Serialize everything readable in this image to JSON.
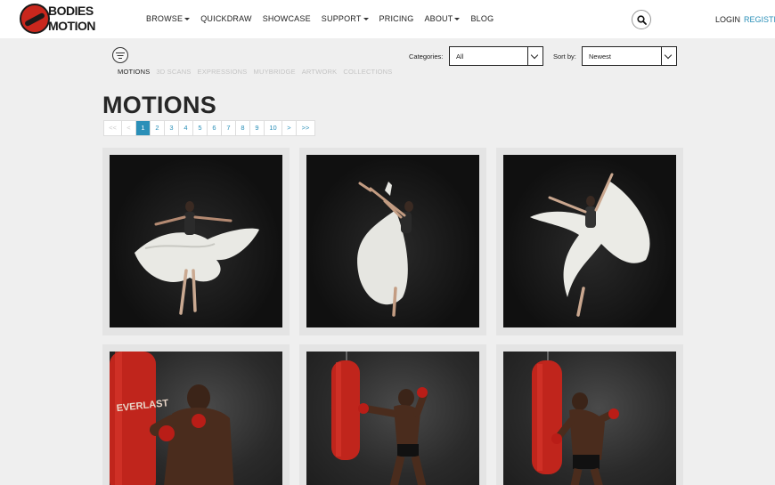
{
  "brand": {
    "line1": "BODIES",
    "on": "IN",
    "line2": "MOTION",
    "accent_color": "#c9271d",
    "link_color": "#2a8fb8"
  },
  "nav": {
    "items": [
      {
        "label": "BROWSE",
        "dropdown": true
      },
      {
        "label": "QUICKDRAW",
        "dropdown": false
      },
      {
        "label": "SHOWCASE",
        "dropdown": false
      },
      {
        "label": "SUPPORT",
        "dropdown": true
      },
      {
        "label": "PRICING",
        "dropdown": false
      },
      {
        "label": "ABOUT",
        "dropdown": true
      },
      {
        "label": "BLOG",
        "dropdown": false
      }
    ],
    "search_icon": "search-icon",
    "login": "LOGIN",
    "register": "REGISTER"
  },
  "filters": {
    "filter_icon": "filter-icon",
    "subtabs": [
      "MOTIONS",
      "3D SCANS",
      "EXPRESSIONS",
      "MUYBRIDGE",
      "ARTWORK",
      "COLLECTIONS"
    ],
    "active_subtab": "MOTIONS",
    "categories_label": "Categories:",
    "categories_value": "All",
    "sort_label": "Sort by:",
    "sort_value": "Newest"
  },
  "page": {
    "title": "MOTIONS"
  },
  "pagination": {
    "first": "<<",
    "prev": "<",
    "pages": [
      "1",
      "2",
      "3",
      "4",
      "5",
      "6",
      "7",
      "8",
      "9",
      "10"
    ],
    "current": "1",
    "next": ">",
    "last": ">>"
  },
  "grid": {
    "items": [
      {
        "subject": "ballet-dancer-white-skirt-spin"
      },
      {
        "subject": "ballet-dancer-arabesque-leap"
      },
      {
        "subject": "ballet-dancer-flowing-fabric"
      },
      {
        "subject": "boxer-punching-bag-hook"
      },
      {
        "subject": "boxer-punching-bag-jab"
      },
      {
        "subject": "boxer-punching-bag-stance"
      }
    ]
  }
}
